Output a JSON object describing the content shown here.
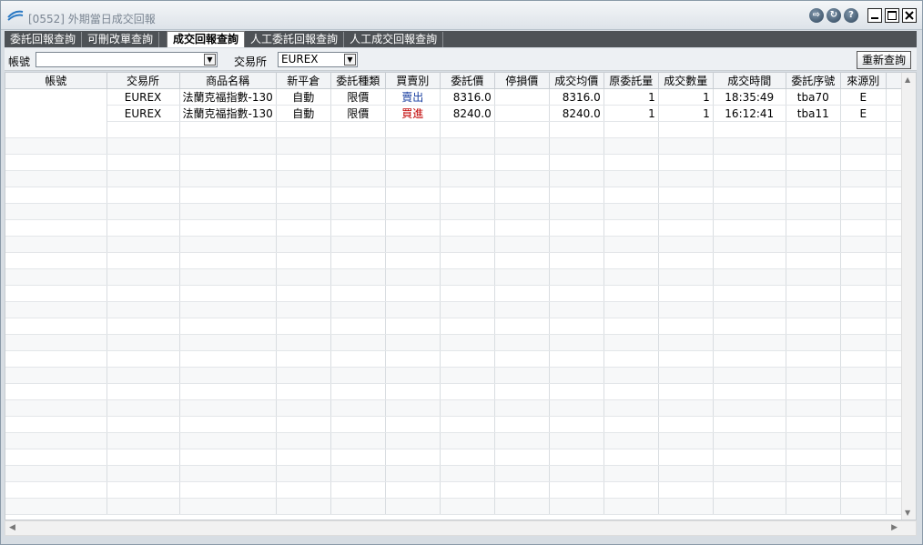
{
  "window": {
    "title": "[0552] 外期當日成交回報"
  },
  "title_buttons": {
    "export": "⇨",
    "refresh": "↻",
    "help": "?"
  },
  "tabs": [
    {
      "label": "委託回報查詢"
    },
    {
      "label": "可刪改單查詢"
    },
    {
      "label": "成交回報查詢"
    },
    {
      "label": "人工委託回報查詢"
    },
    {
      "label": "人工成交回報查詢"
    }
  ],
  "filters": {
    "account_label": "帳號",
    "account_value": "",
    "exchange_label": "交易所",
    "exchange_value": "EUREX",
    "requery_label": "重新查詢"
  },
  "grid": {
    "columns": [
      "帳號",
      "交易所",
      "商品名稱",
      "新平倉",
      "委託種類",
      "買賣別",
      "委託價",
      "停損價",
      "成交均價",
      "原委託量",
      "成交數量",
      "成交時間",
      "委託序號",
      "來源別"
    ],
    "rows": [
      {
        "account": "",
        "exchange": "EUREX",
        "product": "法蘭克福指數-130",
        "open_close": "自動",
        "order_type": "限價",
        "side": "賣出",
        "price": "8316.0",
        "stop": "",
        "avg_price": "8316.0",
        "orig_qty": "1",
        "fill_qty": "1",
        "time": "18:35:49",
        "order_no": "tba70",
        "source": "E"
      },
      {
        "account": "",
        "exchange": "EUREX",
        "product": "法蘭克福指數-130",
        "open_close": "自動",
        "order_type": "限價",
        "side": "買進",
        "price": "8240.0",
        "stop": "",
        "avg_price": "8240.0",
        "orig_qty": "1",
        "fill_qty": "1",
        "time": "16:12:41",
        "order_no": "tba11",
        "source": "E"
      }
    ]
  },
  "colors": {
    "sell": "#1a3fa0",
    "buy": "#c00000",
    "tabbar": "#4e5256"
  }
}
